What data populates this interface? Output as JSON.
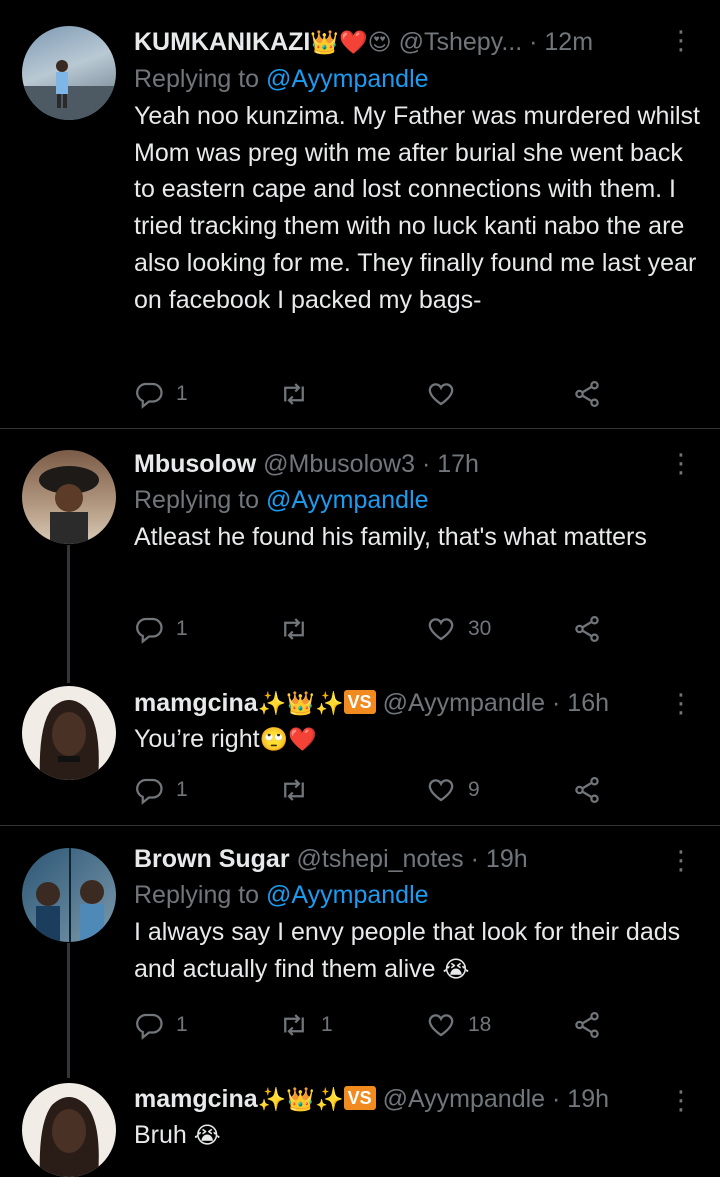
{
  "tweets": [
    {
      "name": "KUMKANIKAZI",
      "name_emojis": "👑❤️😍",
      "handle": "@Tshepy...",
      "time": "· 12m",
      "replying_label": "Replying to",
      "replying_handle": "@Ayympandle",
      "text": "Yeah noo kunzima. My Father was murdered whilst Mom was preg with me after burial she went back to eastern cape and lost connections with them. I tried tracking them with no luck kanti nabo the are also looking for me. They finally found me last year on facebook I packed my bags-",
      "replies": "1",
      "retweets": "",
      "likes": "",
      "avatar_colors": [
        "#6e8aa4",
        "#c9d6df"
      ]
    },
    {
      "name": "Mbusolow",
      "name_emojis": "",
      "handle": "@Mbusolow3",
      "time": "· 17h",
      "replying_label": "Replying to",
      "replying_handle": "@Ayympandle",
      "text": "Atleast he found his family, that's what matters",
      "replies": "1",
      "retweets": "",
      "likes": "30",
      "avatar_colors": [
        "#5a3e2e",
        "#c9b9a4"
      ]
    },
    {
      "name": "mamgcina",
      "name_emojis": "✨👑✨",
      "vs_badge": "VS",
      "handle": "@Ayympandle",
      "time": "· 16h",
      "text": "You’re right",
      "text_emojis": "🙄❤️",
      "replies": "1",
      "retweets": "",
      "likes": "9",
      "avatar_colors": [
        "#3a2a22",
        "#f0e6de"
      ]
    },
    {
      "name": "Brown Sugar",
      "name_emojis": "",
      "handle": "@tshepi_notes",
      "time": "· 19h",
      "replying_label": "Replying to",
      "replying_handle": "@Ayympandle",
      "text": "I always say I envy people that look for their dads and actually find them alive",
      "text_emojis": "😭",
      "replies": "1",
      "retweets": "1",
      "likes": "18",
      "avatar_colors": [
        "#2f5a7a",
        "#8aa7b8"
      ]
    },
    {
      "name": "mamgcina",
      "name_emojis": "✨👑✨",
      "vs_badge": "VS",
      "handle": "@Ayympandle",
      "time": "· 19h",
      "text": "Bruh",
      "text_emojis": "😭",
      "avatar_colors": [
        "#3a2a22",
        "#f0e6de"
      ]
    }
  ],
  "icons": {
    "reply": "reply-icon",
    "retweet": "retweet-icon",
    "like": "heart-icon",
    "share": "share-icon",
    "more": "more-options-icon"
  },
  "colors": {
    "background": "#000000",
    "text": "#e7e9ea",
    "muted": "#71767b",
    "link": "#1d9bf0",
    "divider": "#2f3336"
  }
}
